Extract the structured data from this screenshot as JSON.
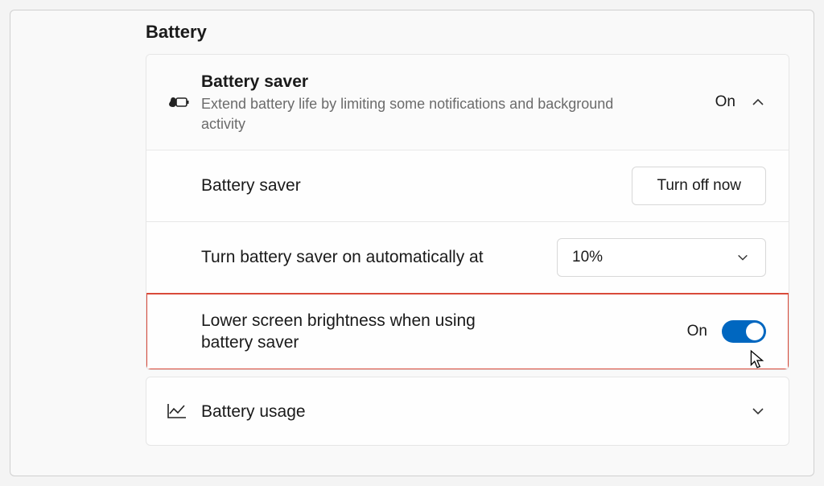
{
  "section_title": "Battery",
  "battery_saver": {
    "title": "Battery saver",
    "subtitle": "Extend battery life by limiting some notifications and background activity",
    "state": "On",
    "sub_label": "Battery saver",
    "turn_off_label": "Turn off now",
    "auto_label": "Turn battery saver on automatically at",
    "auto_value": "10%",
    "brightness_label": "Lower screen brightness when using battery saver",
    "brightness_state": "On"
  },
  "battery_usage": {
    "title": "Battery usage"
  }
}
